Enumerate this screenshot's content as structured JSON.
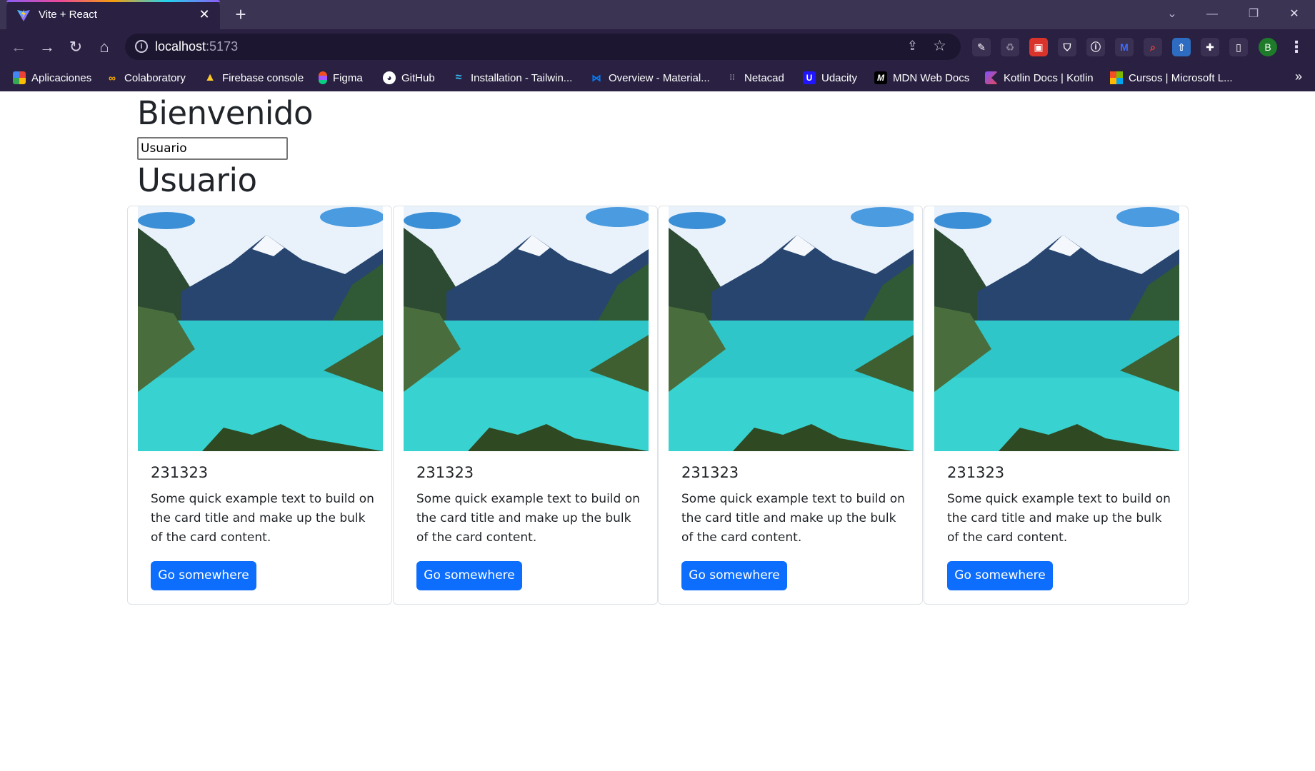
{
  "browser": {
    "tab": {
      "title": "Vite + React"
    },
    "url": {
      "host": "localhost",
      "port": ":5173"
    },
    "profile_initial": "B",
    "bookmarks": [
      {
        "label": "Aplicaciones",
        "icon": "apps-grid-icon"
      },
      {
        "label": "Colaboratory",
        "icon": "colab-icon"
      },
      {
        "label": "Firebase console",
        "icon": "firebase-icon"
      },
      {
        "label": "Figma",
        "icon": "figma-icon"
      },
      {
        "label": "GitHub",
        "icon": "github-icon"
      },
      {
        "label": "Installation - Tailwin...",
        "icon": "tailwind-icon"
      },
      {
        "label": "Overview - Material...",
        "icon": "material-ui-icon"
      },
      {
        "label": "Netacad",
        "icon": "cisco-icon"
      },
      {
        "label": "Udacity",
        "icon": "udacity-icon"
      },
      {
        "label": "MDN Web Docs",
        "icon": "mdn-icon"
      },
      {
        "label": "Kotlin Docs | Kotlin",
        "icon": "kotlin-icon"
      },
      {
        "label": "Cursos | Microsoft L...",
        "icon": "microsoft-icon"
      }
    ],
    "more_bookmarks": "»"
  },
  "page": {
    "welcome": "Bienvenido",
    "input_value": "Usuario",
    "user_heading": "Usuario",
    "cards": [
      {
        "title": "231323",
        "text": "Some quick example text to build on the card title and make up the bulk of the card content.",
        "button": "Go somewhere"
      },
      {
        "title": "231323",
        "text": "Some quick example text to build on the card title and make up the bulk of the card content.",
        "button": "Go somewhere"
      },
      {
        "title": "231323",
        "text": "Some quick example text to build on the card title and make up the bulk of the card content.",
        "button": "Go somewhere"
      },
      {
        "title": "231323",
        "text": "Some quick example text to build on the card title and make up the bulk of the card content.",
        "button": "Go somewhere"
      }
    ]
  },
  "colors": {
    "chrome_frame": "#3b3453",
    "chrome_toolbar": "#2a2142",
    "primary_button": "#0d6efd",
    "text": "#212529"
  }
}
